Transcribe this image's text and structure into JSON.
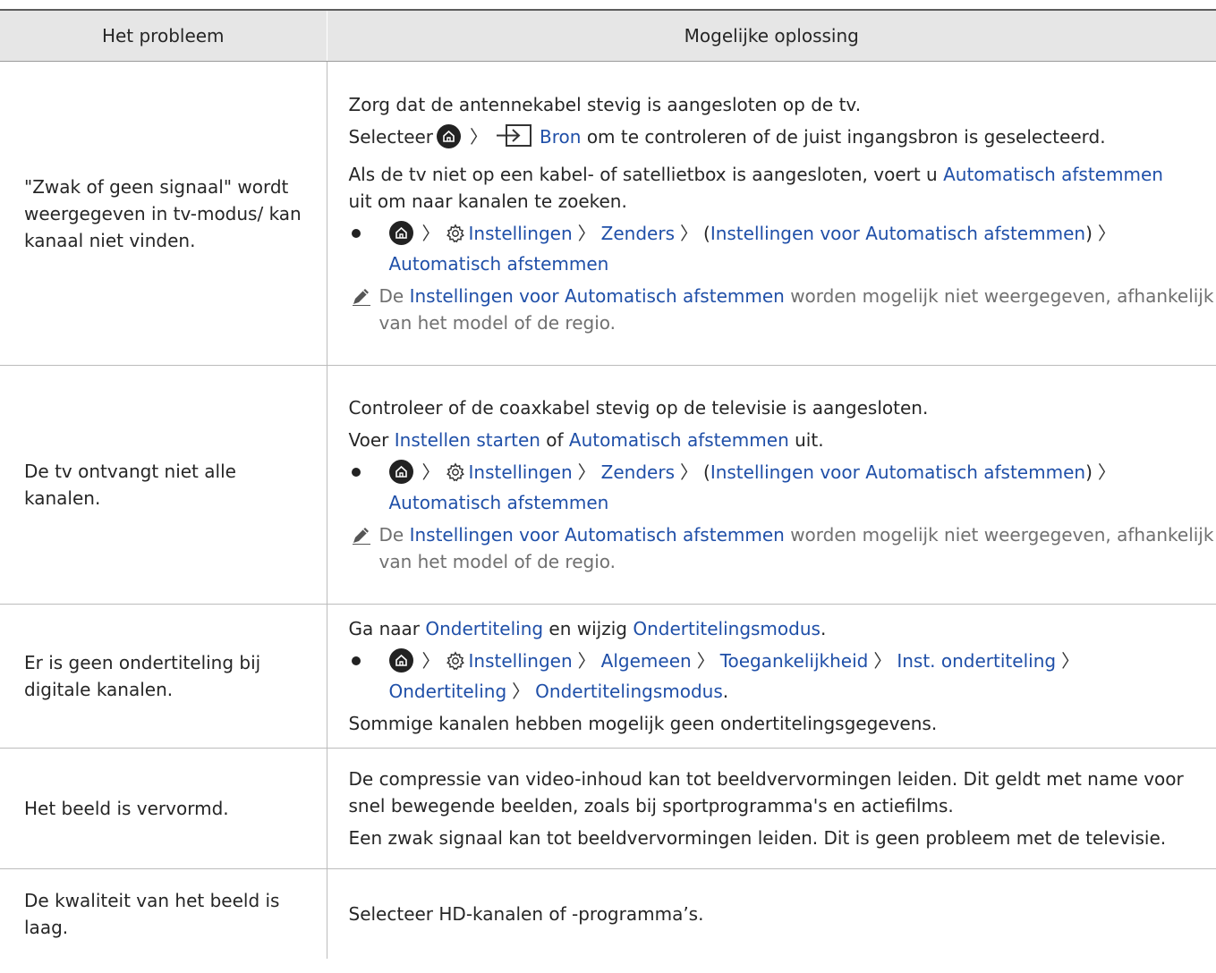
{
  "header": {
    "col1": "Het probleem",
    "col2": "Mogelijke oplossing"
  },
  "row1": {
    "problem": "\"Zwak of geen signaal\" wordt weergegeven in tv-modus/ kan kanaal niet vinden.",
    "l1": "Zorg dat de antennekabel stevig is aangesloten op de tv.",
    "l2_pre": "Selecteer",
    "l2_link": "Bron",
    "l2_post": "om te controleren of de juist ingangsbron is geselecteerd.",
    "l3_pre": "Als de tv niet op een kabel- of satellietbox is aangesloten, voert u",
    "l3_link": "Automatisch afstemmen",
    "l3_post": "uit om naar kanalen te zoeken.",
    "p_settings": "Instellingen",
    "p_channels": "Zenders",
    "p_paren_link": "Instellingen voor Automatisch afstemmen",
    "p_last": "Automatisch afstemmen",
    "note_pre": "De",
    "note_link": "Instellingen voor Automatisch afstemmen",
    "note_post": "worden mogelijk niet weergegeven, afhankelijk van het model of de regio."
  },
  "row2": {
    "problem": "De tv ontvangt niet alle kanalen.",
    "l1": "Controleer of de coaxkabel stevig op de televisie is aangesloten.",
    "l2_pre": "Voer",
    "l2_link1": "Instellen starten",
    "l2_mid": "of",
    "l2_link2": "Automatisch afstemmen",
    "l2_post": "uit.",
    "p_settings": "Instellingen",
    "p_channels": "Zenders",
    "p_paren_link": "Instellingen voor Automatisch afstemmen",
    "p_last": "Automatisch afstemmen",
    "note_pre": "De",
    "note_link": "Instellingen voor Automatisch afstemmen",
    "note_post": "worden mogelijk niet weergegeven, afhankelijk van het model of de regio."
  },
  "row3": {
    "problem": "Er is geen ondertiteling bij digitale kanalen.",
    "l1_pre": "Ga naar",
    "l1_link1": "Ondertiteling",
    "l1_mid": "en wijzig",
    "l1_link2": "Ondertitelingsmodus",
    "l1_post": ".",
    "p_settings": "Instellingen",
    "p_general": "Algemeen",
    "p_access": "Toegankelijkheid",
    "p_caption": "Inst. ondertiteling",
    "p_sub": "Ondertiteling",
    "p_mode": "Ondertitelingsmodus",
    "p_end": ".",
    "l3": "Sommige kanalen hebben mogelijk geen ondertitelingsgegevens."
  },
  "row4": {
    "problem": "Het beeld is vervormd.",
    "l1": "De compressie van video-inhoud kan tot beeldvervormingen leiden. Dit geldt met name voor snel bewegende beelden, zoals bij sportprogramma's en actiefilms.",
    "l2": "Een zwak signaal kan tot beeldvervormingen leiden. Dit is geen probleem met de televisie."
  },
  "row5": {
    "problem": "De kwaliteit van het beeld is laag.",
    "l1": "Selecteer HD-kanalen of -programma’s."
  },
  "colors": {
    "link": "#1f4fa8",
    "header_bg": "#e6e6e6",
    "note": "#707070"
  },
  "icons": [
    "home-icon",
    "gear-icon",
    "source-icon",
    "pencil-icon",
    "chevron-right-icon",
    "bullet-icon"
  ]
}
